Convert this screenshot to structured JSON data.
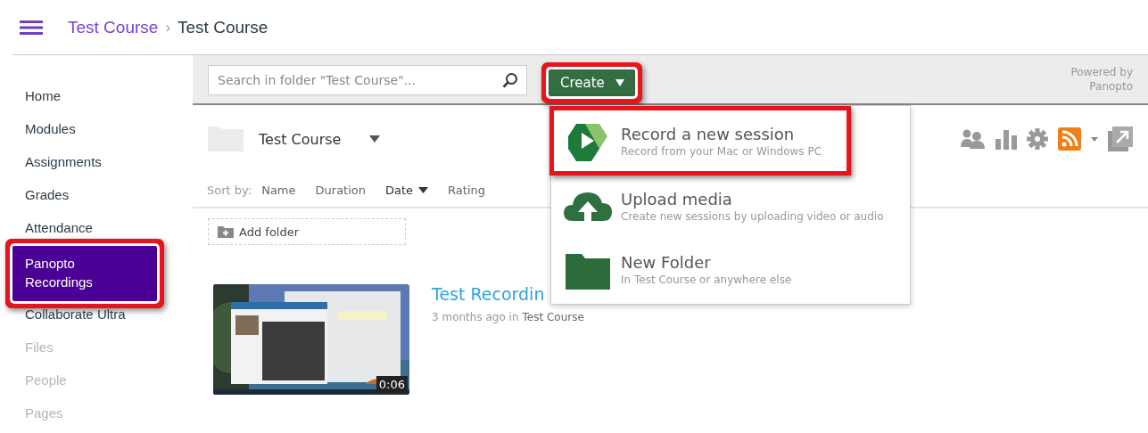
{
  "header": {
    "breadcrumbs": [
      {
        "label": "Test Course",
        "link": true
      },
      {
        "label": "Test Course",
        "link": false
      }
    ],
    "separator": "›"
  },
  "sidebar": {
    "items": [
      {
        "label": "Home",
        "selected": false,
        "disabled": false,
        "highlighted": false
      },
      {
        "label": "Modules",
        "selected": false,
        "disabled": false,
        "highlighted": false
      },
      {
        "label": "Assignments",
        "selected": false,
        "disabled": false,
        "highlighted": false
      },
      {
        "label": "Grades",
        "selected": false,
        "disabled": false,
        "highlighted": false
      },
      {
        "label": "Attendance",
        "selected": false,
        "disabled": false,
        "highlighted": false
      },
      {
        "label": "Panopto Recordings",
        "selected": true,
        "disabled": false,
        "highlighted": true
      },
      {
        "label": "Collaborate Ultra",
        "selected": false,
        "disabled": false,
        "highlighted": false
      },
      {
        "label": "Files",
        "selected": false,
        "disabled": true,
        "highlighted": false
      },
      {
        "label": "People",
        "selected": false,
        "disabled": true,
        "highlighted": false
      },
      {
        "label": "Pages",
        "selected": false,
        "disabled": true,
        "highlighted": false
      }
    ]
  },
  "toolbar": {
    "search": {
      "placeholder": "Search in folder \"Test Course\"..."
    },
    "create_button": {
      "label": "Create",
      "highlighted": true,
      "expanded": true
    },
    "powered_by": [
      "Powered by",
      "Panopto"
    ]
  },
  "create_menu": {
    "items": [
      {
        "kind": "record",
        "title": "Record a new session",
        "subtitle": "Record from your Mac or Windows PC",
        "highlighted": true
      },
      {
        "kind": "upload",
        "title": "Upload media",
        "subtitle": "Create new sessions by uploading video or audio",
        "highlighted": false
      },
      {
        "kind": "folder",
        "title": "New Folder",
        "subtitle": "In Test Course or anywhere else",
        "highlighted": false
      }
    ]
  },
  "folder": {
    "name": "Test Course"
  },
  "sort": {
    "label": "Sort by:",
    "options": [
      {
        "label": "Name",
        "selected": false
      },
      {
        "label": "Duration",
        "selected": false
      },
      {
        "label": "Date",
        "selected": true
      },
      {
        "label": "Rating",
        "selected": false
      }
    ]
  },
  "add_folder": {
    "label": "Add folder"
  },
  "sessions": [
    {
      "title": "Test Recordin",
      "meta": "3 months ago in",
      "folder": "Test Course",
      "duration": "0:06"
    }
  ]
}
